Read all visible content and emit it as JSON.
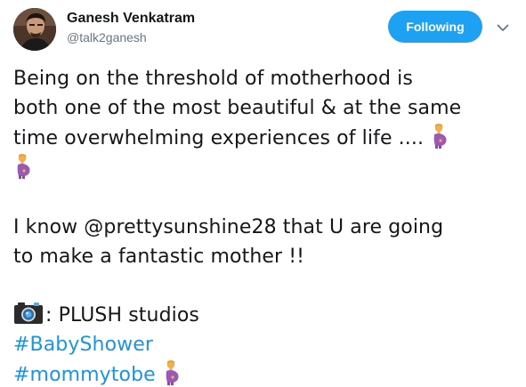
{
  "user": {
    "name": "Ganesh Venkatram",
    "handle": "@talk2ganesh",
    "avatar_icon": "profile-photo"
  },
  "follow_button": {
    "label": "Following",
    "color": "#1da1f2"
  },
  "menu": {
    "icon": "chevron-down-icon"
  },
  "tweet": {
    "line1": "Being on the threshold of motherhood is",
    "line2": "both one of the most beautiful & at the same",
    "line3": "time overwhelming experiences of life ....",
    "line4": "I know @prettysunshine28 that U are going",
    "line5": "to make a fantastic mother !!",
    "credit": ": PLUSH studios",
    "hashtag1": "#BabyShower",
    "hashtag2": "#mommytobe",
    "emoji": "pregnant-woman-icon",
    "credit_icon": "camera-icon",
    "hashtag_color": "#1b95e0"
  }
}
